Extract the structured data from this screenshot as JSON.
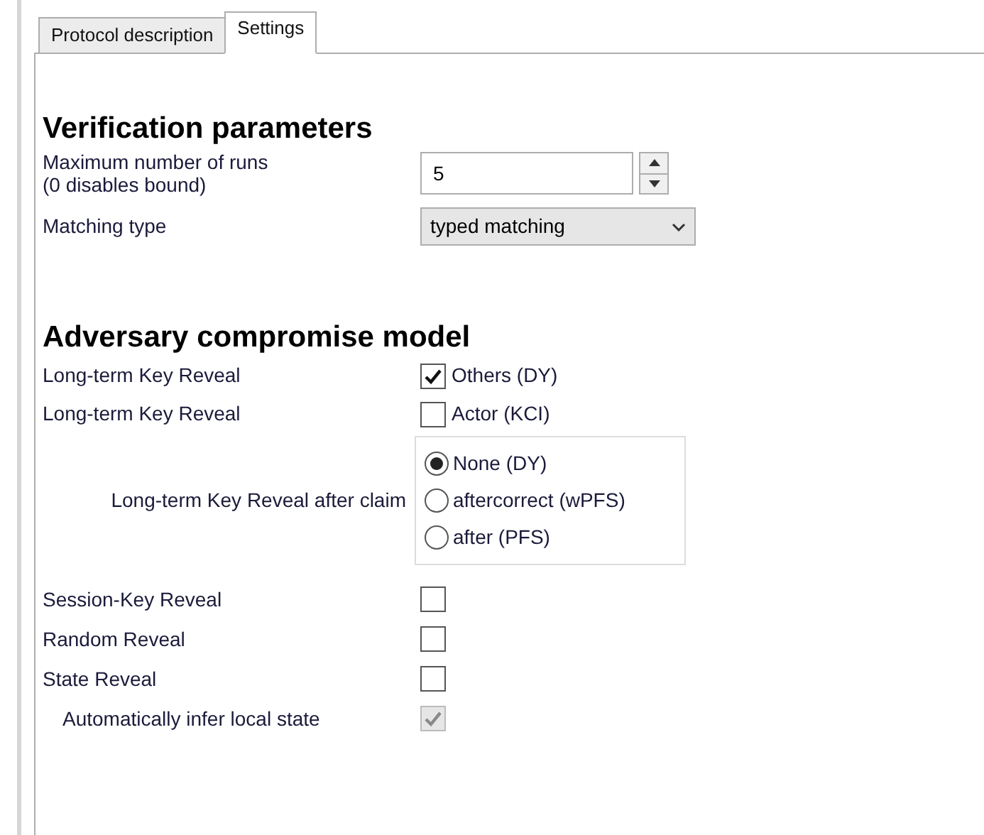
{
  "tabs": [
    {
      "label": "Protocol description",
      "selected": false
    },
    {
      "label": "Settings",
      "selected": true
    }
  ],
  "verification": {
    "title": "Verification parameters",
    "max_runs": {
      "label": "Maximum number of runs\n(0 disables bound)",
      "value": "5"
    },
    "matching_type": {
      "label": "Matching type",
      "value": "typed matching"
    }
  },
  "adversary": {
    "title": "Adversary compromise model",
    "rows_top": [
      {
        "label": "Long-term Key Reveal",
        "option": "Others (DY)",
        "checked": true
      },
      {
        "label": "Long-term Key Reveal",
        "option": "Actor (KCI)",
        "checked": false
      }
    ],
    "after_claim": {
      "label": "Long-term Key Reveal after claim",
      "options": [
        {
          "label": "None (DY)",
          "selected": true
        },
        {
          "label": "aftercorrect (wPFS)",
          "selected": false
        },
        {
          "label": "after (PFS)",
          "selected": false
        }
      ]
    },
    "rows_bottom": [
      {
        "label": "Session-Key Reveal",
        "checked": false,
        "disabled": false,
        "indented": false
      },
      {
        "label": "Random Reveal",
        "checked": false,
        "disabled": false,
        "indented": false
      },
      {
        "label": "State Reveal",
        "checked": false,
        "disabled": false,
        "indented": false
      },
      {
        "label": "Automatically infer local state",
        "checked": true,
        "disabled": true,
        "indented": true
      }
    ]
  }
}
